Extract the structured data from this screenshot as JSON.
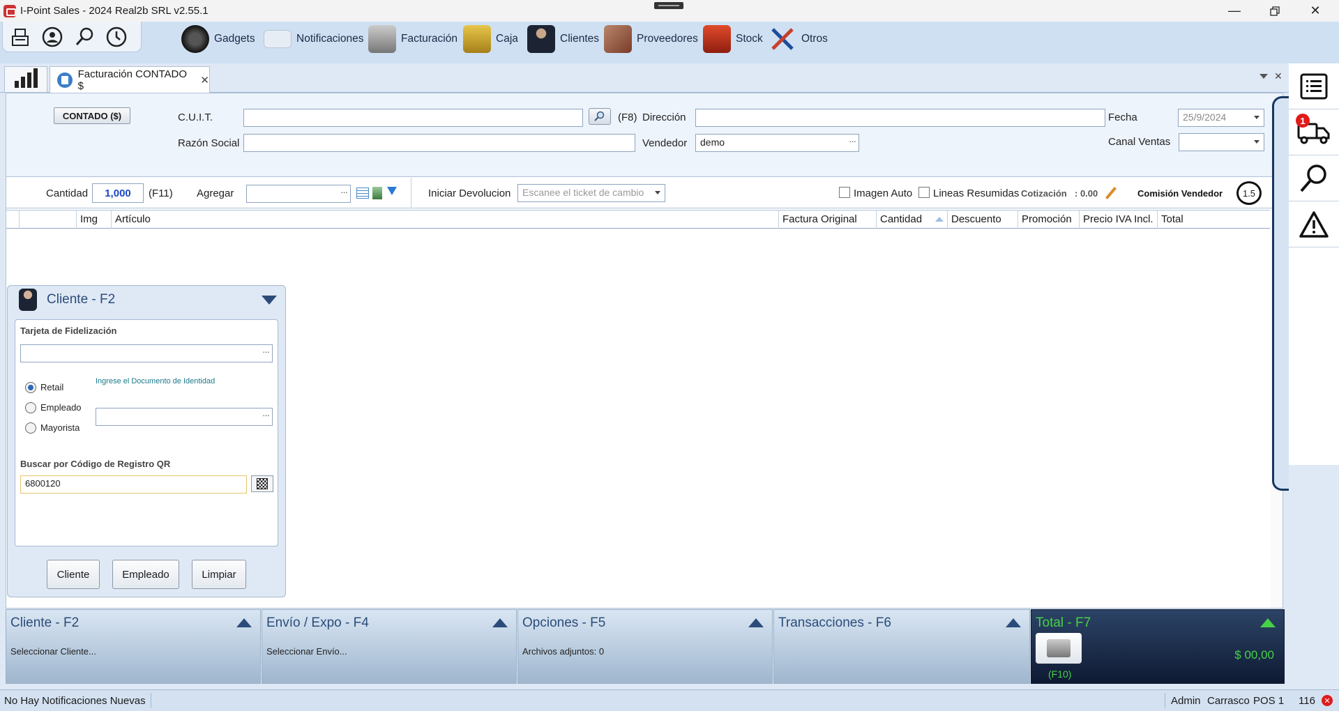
{
  "window": {
    "title": "I-Point Sales  - 2024 Real2b SRL v2.55.1"
  },
  "menu": {
    "items": [
      {
        "label": "Gadgets"
      },
      {
        "label": "Notificaciones"
      },
      {
        "label": "Facturación"
      },
      {
        "label": "Caja"
      },
      {
        "label": "Clientes"
      },
      {
        "label": "Proveedores"
      },
      {
        "label": "Stock"
      },
      {
        "label": "Otros"
      }
    ]
  },
  "tab": {
    "label": "Facturación CONTADO $",
    "close": "✕"
  },
  "header": {
    "contado_button": "CONTADO ($)",
    "cuit_label": "C.U.I.T.",
    "cuit_value": "",
    "f8_label": "(F8)",
    "direccion_label": "Dirección",
    "direccion_value": "",
    "fecha_label": "Fecha",
    "fecha_value": "25/9/2024",
    "razon_label": "Razón Social",
    "razon_value": "",
    "vendedor_label": "Vendedor",
    "vendedor_value": "demo",
    "canal_label": "Canal Ventas",
    "canal_value": ""
  },
  "toolbar": {
    "cantidad_label": "Cantidad",
    "cantidad_value": "1,000",
    "f11_label": "(F11)",
    "agregar_label": "Agregar",
    "devolucion_label": "Iniciar Devolucion",
    "devolucion_placeholder": "Escanee el ticket de cambio",
    "imagen_auto_label": "Imagen Auto",
    "lineas_label": "Lineas Resumidas",
    "cotizacion_label": "Cotización",
    "cotizacion_value": ": 0.00",
    "comision_label": "Comisión Vendedor",
    "comision_value": "1.5"
  },
  "grid": {
    "columns": [
      "Img",
      "Artículo",
      "Factura Original",
      "Cantidad",
      "Descuento",
      "Promoción",
      "Precio IVA Incl.",
      "Total"
    ]
  },
  "client_panel": {
    "title": "Cliente - F2",
    "fidelizacion_label": "Tarjeta de Fidelización",
    "fidelizacion_value": "",
    "radios": [
      {
        "label": "Retail",
        "checked": true
      },
      {
        "label": "Empleado",
        "checked": false
      },
      {
        "label": "Mayorista",
        "checked": false
      }
    ],
    "documento_hint": "Ingrese el Documento de Identidad",
    "documento_value": "",
    "qr_label": "Buscar por Código de Registro QR",
    "qr_value": "6800120",
    "buttons": {
      "cliente": "Cliente",
      "empleado": "Empleado",
      "limpiar": "Limpiar"
    }
  },
  "bottom_panels": [
    {
      "title": "Cliente - F2",
      "subtitle": "Seleccionar Cliente..."
    },
    {
      "title": "Envío / Expo - F4",
      "subtitle": "Seleccionar Envío..."
    },
    {
      "title": "Opciones - F5",
      "subtitle": "Archivos adjuntos: 0"
    },
    {
      "title": "Transacciones - F6",
      "subtitle": ""
    }
  ],
  "total_panel": {
    "title": "Total - F7",
    "amount": "$ 00,00",
    "f10": "(F10)"
  },
  "statusbar": {
    "notifications": "No Hay Notificaciones Nuevas",
    "user": "Admin",
    "location": "Carrasco",
    "pos": "POS 1",
    "count": "116"
  },
  "right_strip": {
    "badge": "1"
  },
  "colors": {
    "accent": "#2b4c7a",
    "total_green": "#47d147",
    "badge_red": "#e01b1b"
  }
}
